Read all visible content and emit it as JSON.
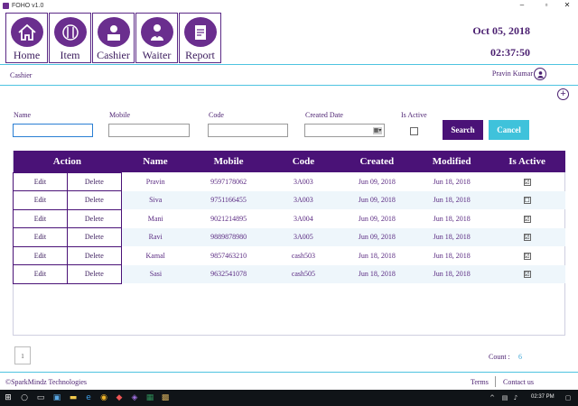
{
  "window": {
    "title": "FOHO v1.0",
    "minimize": "–",
    "maximize": "▫",
    "close": "✕"
  },
  "nav": [
    {
      "label": "Home",
      "icon": "home-icon"
    },
    {
      "label": "Item",
      "icon": "cutlery-icon"
    },
    {
      "label": "Cashier",
      "icon": "cashier-icon"
    },
    {
      "label": "Waiter",
      "icon": "waiter-icon"
    },
    {
      "label": "Report",
      "icon": "report-icon"
    }
  ],
  "header": {
    "date": "Oct 05, 2018",
    "time": "02:37:50"
  },
  "breadcrumb": "Cashier",
  "user": {
    "name": "Pravin Kumar"
  },
  "add_label": "+",
  "filters": {
    "name_label": "Name",
    "mobile_label": "Mobile",
    "code_label": "Code",
    "created_date_label": "Created Date",
    "is_active_label": "Is Active",
    "date_dropdown_glyph": "▦▾",
    "search_label": "Search",
    "cancel_label": "Cancel"
  },
  "table": {
    "columns": [
      "Action",
      "Name",
      "Mobile",
      "Code",
      "Created",
      "Modified",
      "Is Active"
    ],
    "edit_label": "Edit",
    "delete_label": "Delete",
    "rows": [
      {
        "name": "Pravin",
        "mobile": "9597178062",
        "code": "3A003",
        "created": "Jun 09, 2018",
        "modified": "Jun 18, 2018",
        "active": "☑"
      },
      {
        "name": "Siva",
        "mobile": "9751166455",
        "code": "3A003",
        "created": "Jun 09, 2018",
        "modified": "Jun 18, 2018",
        "active": "☐"
      },
      {
        "name": "Mani",
        "mobile": "9021214895",
        "code": "3A004",
        "created": "Jun 09, 2018",
        "modified": "Jun 18, 2018",
        "active": "☑"
      },
      {
        "name": "Ravi",
        "mobile": "9889878980",
        "code": "3A005",
        "created": "Jun 09, 2018",
        "modified": "Jun 18, 2018",
        "active": "☑"
      },
      {
        "name": "Kamal",
        "mobile": "9857463210",
        "code": "cash503",
        "created": "Jun 18, 2018",
        "modified": "Jun 18, 2018",
        "active": "☑"
      },
      {
        "name": "Sasi",
        "mobile": "9632541078",
        "code": "cash505",
        "created": "Jun 18, 2018",
        "modified": "Jun 18, 2018",
        "active": "☑"
      }
    ]
  },
  "pagination": {
    "page": "1"
  },
  "count": {
    "label": "Count :",
    "value": "6"
  },
  "footer": {
    "copyright": "©SparkMindz Technologies",
    "terms": "Terms",
    "contact": "Contact us"
  },
  "taskbar": {
    "time": "02:37 PM"
  }
}
